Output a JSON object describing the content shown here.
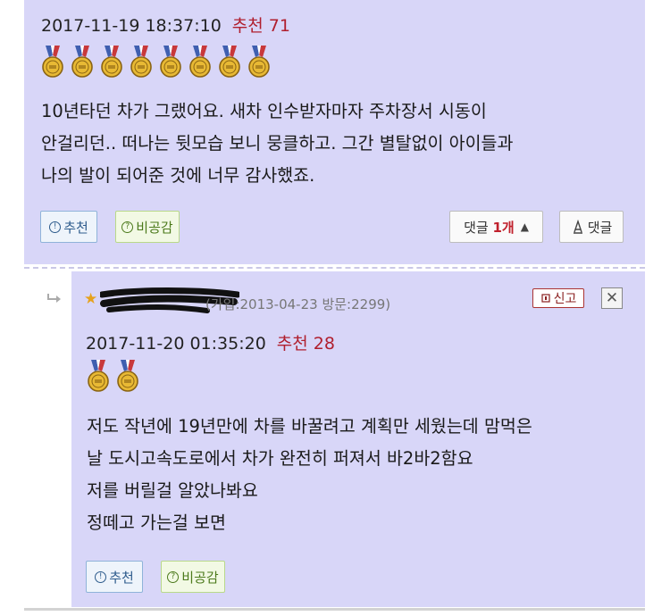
{
  "comment1": {
    "datetime": "2017-11-19 18:37:10",
    "recommend_label": "추천 71",
    "medal_count": 8,
    "lines": [
      "10년타던 차가 그랬어요. 새차 인수받자마자 주차장서 시동이",
      "안걸리던.. 떠나는 뒷모습 보니 뭉클하고. 그간 별탈없이 아이들과",
      "나의 발이 되어준 것에 너무 감사했죠."
    ],
    "recommend_button": "추천",
    "unagree_button": "비공감",
    "reply_label": "댓글",
    "reply_count": "1개",
    "write_reply_button": "댓글"
  },
  "comment2": {
    "join_info": "(가입:2013-04-23 방문:2299)",
    "report_button": "신고",
    "close_glyph": "✕",
    "datetime": "2017-11-20 01:35:20",
    "recommend_label": "추천 28",
    "medal_count": 2,
    "lines": [
      "저도 작년에 19년만에 차를 바꿀려고 계획만 세웠는데 맘먹은",
      "날 도시고속도로에서 차가 완전히 퍼져서 바2바2함요",
      "저를 버릴걸 알았나봐요",
      "정떼고 가는걸 보면"
    ],
    "recommend_button": "추천",
    "unagree_button": "비공감"
  },
  "colors": {
    "post_bg": "#d8d6f8",
    "recommend_red": "#b01f2e",
    "medal_gold": "#e8b934"
  }
}
